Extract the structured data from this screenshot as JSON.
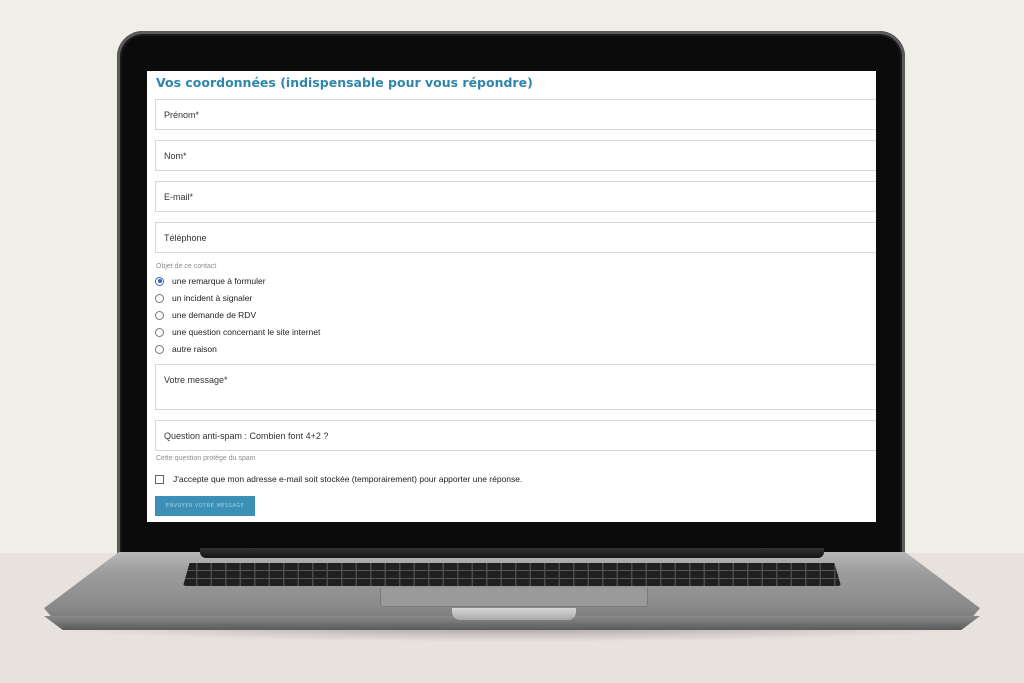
{
  "form": {
    "title": "Vos coordonnées (indispensable pour vous répondre)",
    "fields": {
      "prenom": "Prénom*",
      "nom": "Nom*",
      "email": "E-mail*",
      "telephone": "Téléphone"
    },
    "subject": {
      "label": "Objet de ce contact",
      "options": [
        "une remarque à formuler",
        "un incident à signaler",
        "une demande de RDV",
        "une question concernant le site internet",
        "autre raison"
      ],
      "selected": "une remarque à formuler"
    },
    "message": "Votre message*",
    "antispam": {
      "question": "Question anti-spam : Combien font 4+2 ?",
      "hint": "Cette question protège du spam"
    },
    "consent": "J'accepte que mon adresse e-mail soit stockée (temporairement) pour apporter une réponse.",
    "submit": "ENVOYER VOTRE MESSAGE"
  },
  "colors": {
    "title": "#2f86ab",
    "button": "#3c90b7",
    "radio_checked": "#3b5fb0"
  }
}
